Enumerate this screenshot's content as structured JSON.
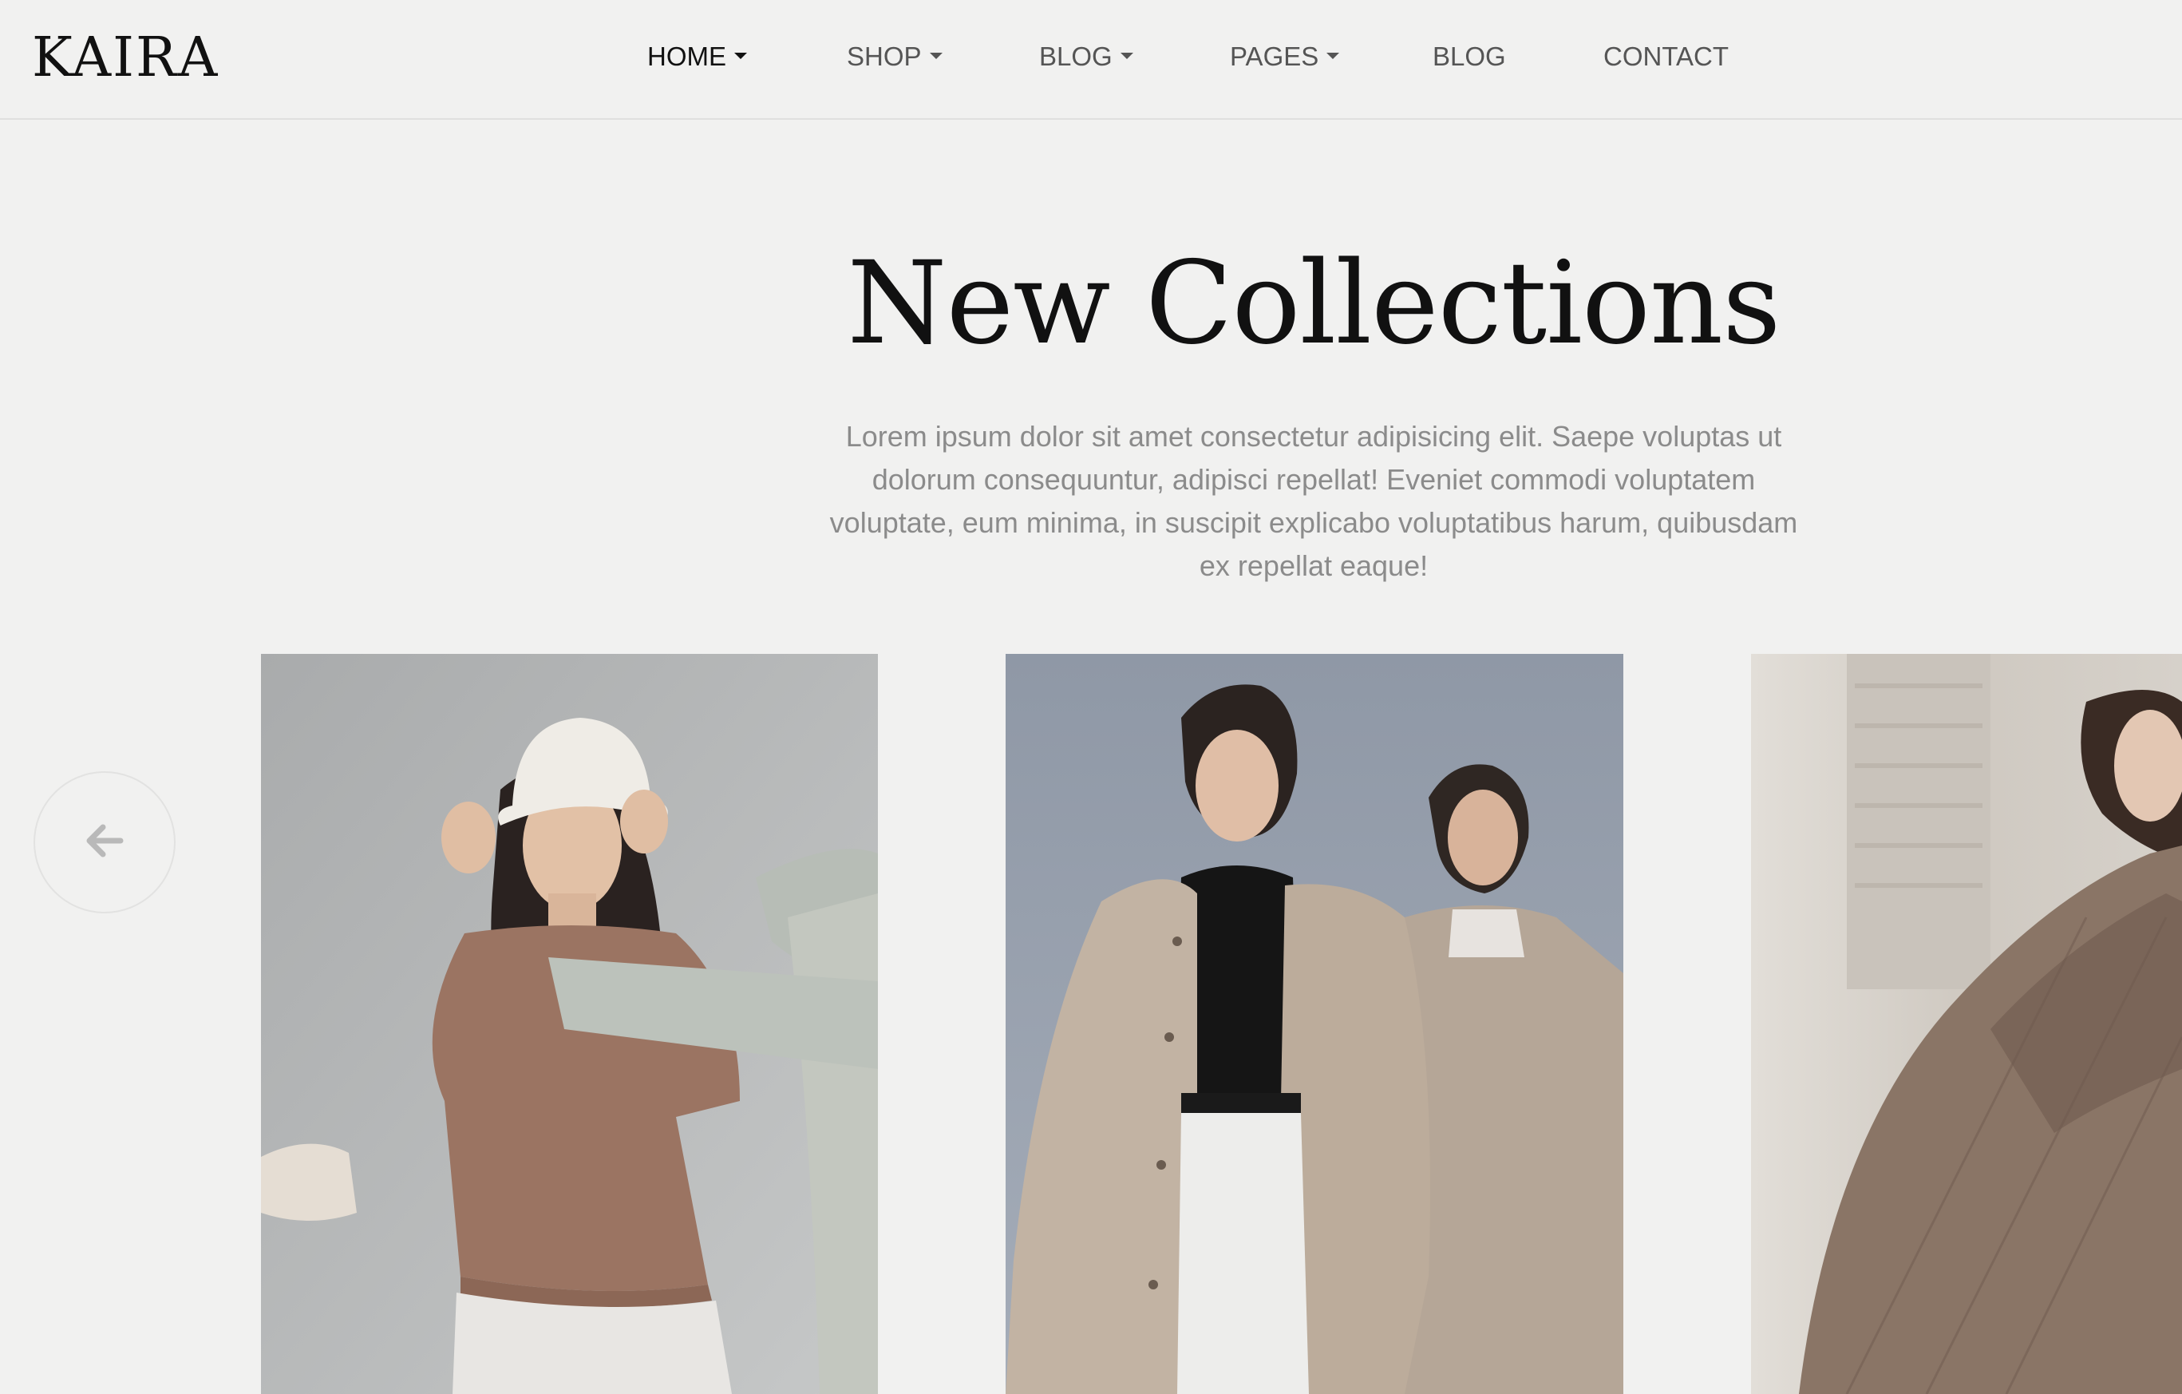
{
  "brand": {
    "logo": "KAIRA"
  },
  "nav": {
    "items": [
      {
        "label": "HOME",
        "has_dropdown": true,
        "active": true
      },
      {
        "label": "SHOP",
        "has_dropdown": true,
        "active": false
      },
      {
        "label": "BLOG",
        "has_dropdown": true,
        "active": false
      },
      {
        "label": "PAGES",
        "has_dropdown": true,
        "active": false
      },
      {
        "label": "BLOG",
        "has_dropdown": false,
        "active": false
      },
      {
        "label": "CONTACT",
        "has_dropdown": false,
        "active": false
      }
    ]
  },
  "hero": {
    "title": "New Collections",
    "description": "Lorem ipsum dolor sit amet consectetur adipisicing elit. Saepe voluptas ut dolorum consequuntur, adipisci repellat! Eveniet commodi voluptatem voluptate, eum minima, in suscipit explicabo voluptatibus harum, quibusdam ex repellat eaque!"
  },
  "carousel": {
    "prev_icon": "arrow-left-icon",
    "cards": [
      {
        "image": "model-white-bucket-hat-brown-top"
      },
      {
        "image": "two-models-beige-trench-coats"
      },
      {
        "image": "model-brown-plaid-blazer"
      }
    ]
  },
  "colors": {
    "background": "#f1f1f0",
    "text_dark": "#111111",
    "text_muted": "#8b8b8b",
    "nav_text": "#555555"
  }
}
